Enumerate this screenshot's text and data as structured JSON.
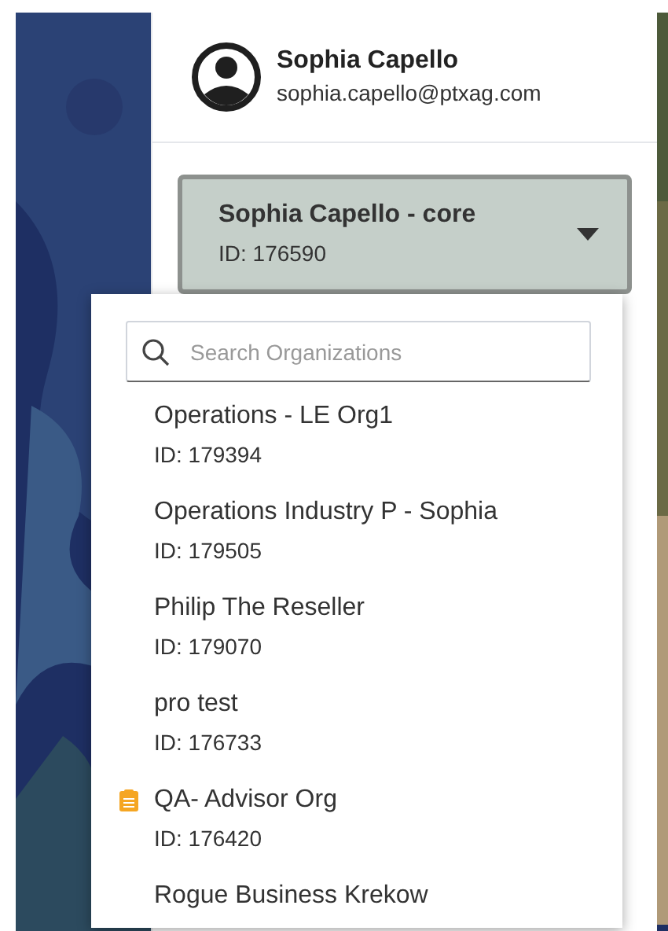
{
  "user": {
    "name": "Sophia Capello",
    "email": "sophia.capello@ptxag.com"
  },
  "current_org": {
    "name": "Sophia Capello - core",
    "id": "ID: 176590",
    "expanded": true
  },
  "search": {
    "placeholder": "Search Organizations"
  },
  "organizations": [
    {
      "kind": "plain",
      "name": "Operations - LE Org1",
      "id": "ID: 179394"
    },
    {
      "kind": "plain",
      "name": "Operations Industry P - Sophia",
      "id": "ID: 179505"
    },
    {
      "kind": "plain",
      "name": "Philip The Reseller",
      "id": "ID: 179070"
    },
    {
      "kind": "plain",
      "name": "pro test",
      "id": "ID: 176733"
    },
    {
      "kind": "advisor",
      "name": "QA- Advisor Org",
      "id": "ID: 176420"
    },
    {
      "kind": "plain",
      "name": "Rogue Business Krekow"
    }
  ]
}
